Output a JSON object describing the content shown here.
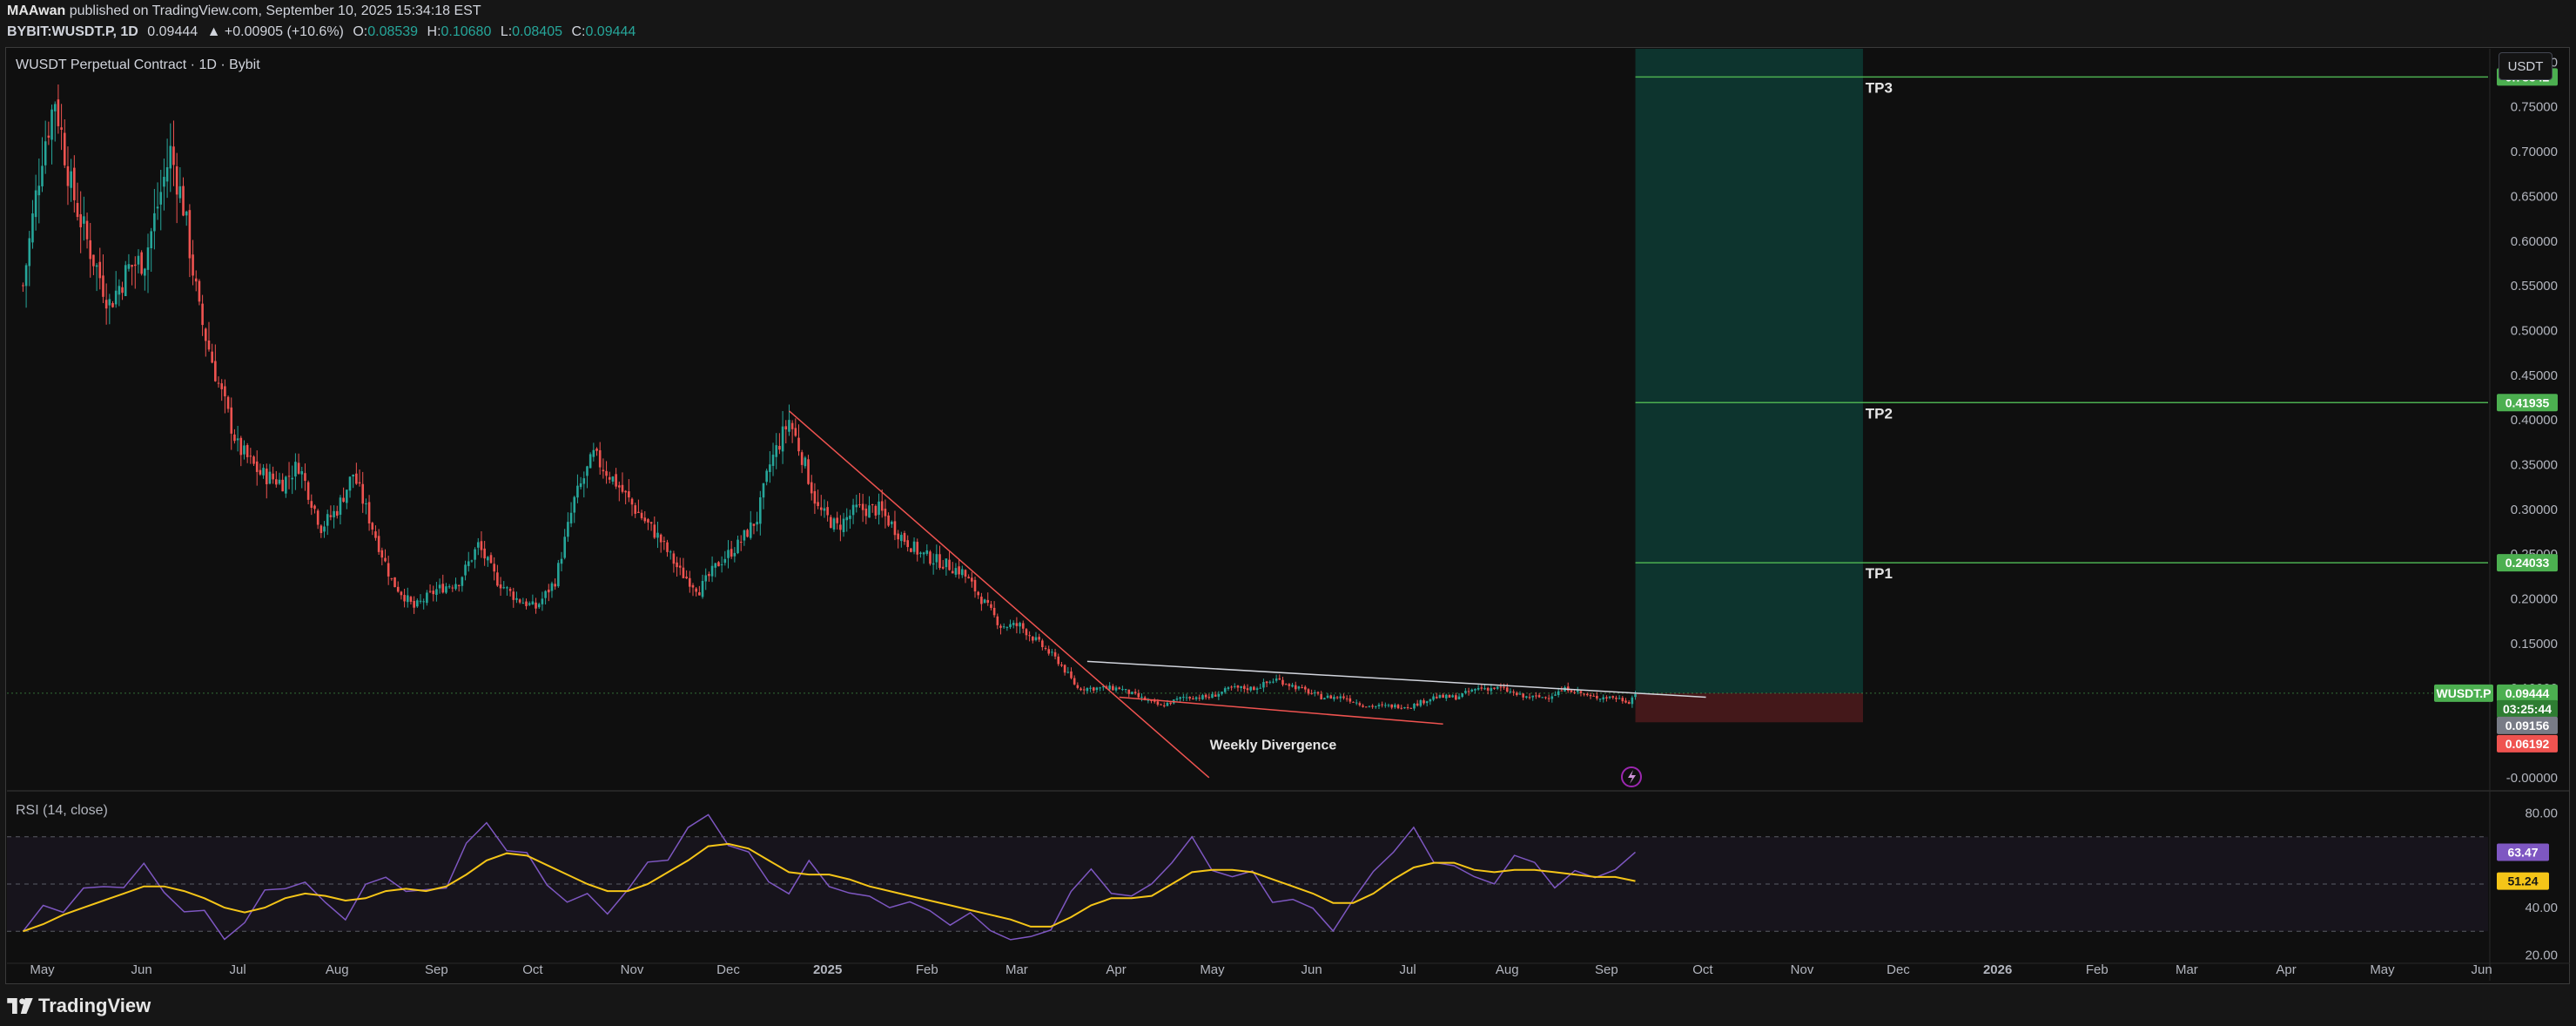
{
  "header": {
    "author": "MAAwan",
    "published": "published on TradingView.com, September 10, 2025 15:34:18 EST",
    "symbol": "BYBIT:WUSDT.P, 1D",
    "last": "0.09444",
    "change": "▲ +0.00905 (+10.6%)",
    "o_label": "O:",
    "o": "0.08539",
    "h_label": "H:",
    "h": "0.10680",
    "l_label": "L:",
    "l": "0.08405",
    "c_label": "C:",
    "c": "0.09444"
  },
  "chart": {
    "title": "WUSDT Perpetual Contract · 1D · Bybit",
    "unit_button": "USDT",
    "rsi_title": "RSI (14, close)"
  },
  "footer": {
    "brand": "TradingView"
  },
  "colors": {
    "up": "#26a69a",
    "down": "#ef5350",
    "tp": "#4caf50",
    "rsi": "#7e57c2",
    "rsi_ma": "#f5c518"
  },
  "chart_data": [
    {
      "type": "candlestick",
      "title": "WUSDT Perpetual Contract · 1D · Bybit",
      "x_tick_labels": [
        "May",
        "Jun",
        "Jul",
        "Aug",
        "Sep",
        "Oct",
        "Nov",
        "Dec",
        "2025",
        "Feb",
        "Mar",
        "Apr",
        "May",
        "Jun",
        "Jul",
        "Aug",
        "Sep",
        "Oct",
        "Nov",
        "Dec",
        "2026",
        "Feb",
        "Mar",
        "Apr",
        "May",
        "Jun"
      ],
      "y_tick_labels": [
        "0.80000",
        "0.75000",
        "0.70000",
        "0.65000",
        "0.60000",
        "0.55000",
        "0.50000",
        "0.45000",
        "0.40000",
        "0.35000",
        "0.30000",
        "0.25000",
        "0.20000",
        "0.15000",
        "0.10000",
        "-0.00000"
      ],
      "ylim": [
        -0.005,
        0.815
      ],
      "close_path": [
        {
          "x": "2024-04-25",
          "y": 0.55
        },
        {
          "x": "2024-05-01",
          "y": 0.7
        },
        {
          "x": "2024-05-05",
          "y": 0.76
        },
        {
          "x": "2024-05-10",
          "y": 0.66
        },
        {
          "x": "2024-05-15",
          "y": 0.6
        },
        {
          "x": "2024-05-22",
          "y": 0.53
        },
        {
          "x": "2024-05-28",
          "y": 0.57
        },
        {
          "x": "2024-06-02",
          "y": 0.58
        },
        {
          "x": "2024-06-06",
          "y": 0.64
        },
        {
          "x": "2024-06-10",
          "y": 0.7
        },
        {
          "x": "2024-06-14",
          "y": 0.64
        },
        {
          "x": "2024-06-19",
          "y": 0.52
        },
        {
          "x": "2024-06-25",
          "y": 0.44
        },
        {
          "x": "2024-07-01",
          "y": 0.37
        },
        {
          "x": "2024-07-08",
          "y": 0.34
        },
        {
          "x": "2024-07-15",
          "y": 0.33
        },
        {
          "x": "2024-07-20",
          "y": 0.35
        },
        {
          "x": "2024-07-27",
          "y": 0.28
        },
        {
          "x": "2024-08-01",
          "y": 0.3
        },
        {
          "x": "2024-08-06",
          "y": 0.34
        },
        {
          "x": "2024-08-12",
          "y": 0.28
        },
        {
          "x": "2024-08-18",
          "y": 0.22
        },
        {
          "x": "2024-08-25",
          "y": 0.19
        },
        {
          "x": "2024-09-01",
          "y": 0.21
        },
        {
          "x": "2024-09-08",
          "y": 0.22
        },
        {
          "x": "2024-09-14",
          "y": 0.26
        },
        {
          "x": "2024-09-20",
          "y": 0.22
        },
        {
          "x": "2024-09-26",
          "y": 0.2
        },
        {
          "x": "2024-10-02",
          "y": 0.19
        },
        {
          "x": "2024-10-08",
          "y": 0.22
        },
        {
          "x": "2024-10-14",
          "y": 0.31
        },
        {
          "x": "2024-10-20",
          "y": 0.36
        },
        {
          "x": "2024-10-27",
          "y": 0.33
        },
        {
          "x": "2024-11-02",
          "y": 0.3
        },
        {
          "x": "2024-11-09",
          "y": 0.27
        },
        {
          "x": "2024-11-16",
          "y": 0.23
        },
        {
          "x": "2024-11-22",
          "y": 0.21
        },
        {
          "x": "2024-11-28",
          "y": 0.24
        },
        {
          "x": "2024-12-04",
          "y": 0.26
        },
        {
          "x": "2024-12-10",
          "y": 0.29
        },
        {
          "x": "2024-12-14",
          "y": 0.35
        },
        {
          "x": "2024-12-20",
          "y": 0.4
        },
        {
          "x": "2024-12-24",
          "y": 0.36
        },
        {
          "x": "2024-12-29",
          "y": 0.3
        },
        {
          "x": "2025-01-04",
          "y": 0.28
        },
        {
          "x": "2025-01-10",
          "y": 0.3
        },
        {
          "x": "2025-01-17",
          "y": 0.3
        },
        {
          "x": "2025-01-24",
          "y": 0.27
        },
        {
          "x": "2025-01-30",
          "y": 0.25
        },
        {
          "x": "2025-02-06",
          "y": 0.24
        },
        {
          "x": "2025-02-12",
          "y": 0.23
        },
        {
          "x": "2025-02-18",
          "y": 0.2
        },
        {
          "x": "2025-02-24",
          "y": 0.17
        },
        {
          "x": "2025-03-02",
          "y": 0.17
        },
        {
          "x": "2025-03-08",
          "y": 0.15
        },
        {
          "x": "2025-03-14",
          "y": 0.13
        },
        {
          "x": "2025-03-20",
          "y": 0.1
        },
        {
          "x": "2025-03-27",
          "y": 0.1
        },
        {
          "x": "2025-04-02",
          "y": 0.1
        },
        {
          "x": "2025-04-08",
          "y": 0.09
        },
        {
          "x": "2025-04-15",
          "y": 0.08
        },
        {
          "x": "2025-04-22",
          "y": 0.09
        },
        {
          "x": "2025-04-30",
          "y": 0.09
        },
        {
          "x": "2025-05-07",
          "y": 0.1
        },
        {
          "x": "2025-05-14",
          "y": 0.1
        },
        {
          "x": "2025-05-21",
          "y": 0.11
        },
        {
          "x": "2025-05-28",
          "y": 0.1
        },
        {
          "x": "2025-06-04",
          "y": 0.09
        },
        {
          "x": "2025-06-11",
          "y": 0.09
        },
        {
          "x": "2025-06-18",
          "y": 0.08
        },
        {
          "x": "2025-06-25",
          "y": 0.08
        },
        {
          "x": "2025-07-02",
          "y": 0.08
        },
        {
          "x": "2025-07-09",
          "y": 0.09
        },
        {
          "x": "2025-07-16",
          "y": 0.09
        },
        {
          "x": "2025-07-23",
          "y": 0.1
        },
        {
          "x": "2025-07-30",
          "y": 0.1
        },
        {
          "x": "2025-08-06",
          "y": 0.09
        },
        {
          "x": "2025-08-13",
          "y": 0.09
        },
        {
          "x": "2025-08-20",
          "y": 0.1
        },
        {
          "x": "2025-08-27",
          "y": 0.09
        },
        {
          "x": "2025-09-03",
          "y": 0.09
        },
        {
          "x": "2025-09-08",
          "y": 0.085
        },
        {
          "x": "2025-09-10",
          "y": 0.09444
        }
      ],
      "trendlines": [
        {
          "name": "downtrend",
          "color": "#ef5350",
          "from": {
            "x": "2024-12-20",
            "y": 0.41
          },
          "to": {
            "x": "2025-04-30",
            "y": 0.0
          }
        },
        {
          "name": "resistance",
          "color": "#d1d4dc",
          "from": {
            "x": "2025-03-23",
            "y": 0.13
          },
          "to": {
            "x": "2025-10-02",
            "y": 0.09
          }
        },
        {
          "name": "divergence-support",
          "color": "#ef5350",
          "from": {
            "x": "2025-04-02",
            "y": 0.09
          },
          "to": {
            "x": "2025-07-12",
            "y": 0.06
          }
        }
      ],
      "annotations": [
        {
          "label": "Weekly Divergence",
          "x": "2025-05-20",
          "y": 0.045
        },
        {
          "label": "TP3",
          "value": 0.78342,
          "x": "2025-11-25"
        },
        {
          "label": "TP2",
          "value": 0.41935,
          "x": "2025-11-25"
        },
        {
          "label": "TP1",
          "value": 0.24033,
          "x": "2025-11-25"
        }
      ],
      "position": {
        "type": "long",
        "start": "2025-09-10",
        "end": "2025-11-20",
        "entry": 0.09444,
        "stop": 0.06192,
        "target": 0.78342
      },
      "price_labels": [
        {
          "text": "0.78342",
          "value": 0.78342,
          "color": "#4caf50"
        },
        {
          "text": "0.41935",
          "value": 0.41935,
          "color": "#4caf50"
        },
        {
          "text": "0.24033",
          "value": 0.24033,
          "color": "#4caf50"
        },
        {
          "text": "WUSDT.P",
          "value": 0.09444,
          "color": "#4caf50"
        },
        {
          "text": "0.09444",
          "value": 0.09444,
          "color": "#4caf50"
        },
        {
          "text": "03:25:44",
          "value": 0.09444,
          "color": "#2e7d32"
        },
        {
          "text": "0.09156",
          "value": 0.09156,
          "color": "#787b86"
        },
        {
          "text": "0.06192",
          "value": 0.06192,
          "color": "#ef5350"
        }
      ]
    },
    {
      "type": "line",
      "title": "RSI (14, close)",
      "y_tick_labels": [
        "80.00",
        "40.00",
        "20.00"
      ],
      "ylim": [
        15,
        85
      ],
      "bands": [
        70,
        50,
        30
      ],
      "series": [
        {
          "values": [
            30,
            38,
            42,
            46,
            48,
            52,
            55,
            48,
            40,
            35,
            30,
            33,
            45,
            52,
            48,
            42,
            38,
            46,
            55,
            48,
            44,
            52,
            66,
            74,
            68,
            60,
            50,
            45,
            42,
            40,
            48,
            56,
            64,
            72,
            78,
            70,
            60,
            52,
            48,
            56,
            52,
            46,
            42,
            44,
            40,
            38,
            36,
            34,
            32,
            28,
            24,
            34,
            46,
            54,
            50,
            42,
            50,
            62,
            66,
            58,
            54,
            52,
            46,
            42,
            38,
            34,
            40,
            56,
            66,
            70,
            62,
            58,
            50,
            54,
            60,
            58,
            52,
            52,
            54,
            58,
            63.47
          ]
        },
        {
          "values": [
            30,
            33,
            37,
            40,
            43,
            46,
            49,
            49,
            47,
            44,
            40,
            38,
            40,
            44,
            46,
            45,
            43,
            44,
            47,
            48,
            47,
            49,
            54,
            60,
            63,
            62,
            58,
            54,
            50,
            47,
            47,
            50,
            55,
            60,
            66,
            67,
            65,
            60,
            55,
            54,
            54,
            52,
            49,
            47,
            45,
            43,
            41,
            39,
            37,
            35,
            32,
            32,
            36,
            41,
            44,
            44,
            45,
            50,
            55,
            56,
            56,
            55,
            52,
            49,
            46,
            42,
            42,
            46,
            52,
            57,
            59,
            59,
            56,
            55,
            56,
            56,
            55,
            54,
            53,
            53,
            51.24
          ]
        }
      ],
      "value_labels": [
        {
          "text": "63.47",
          "color": "#7e57c2"
        },
        {
          "text": "51.24",
          "color": "#f5c518"
        }
      ]
    }
  ]
}
